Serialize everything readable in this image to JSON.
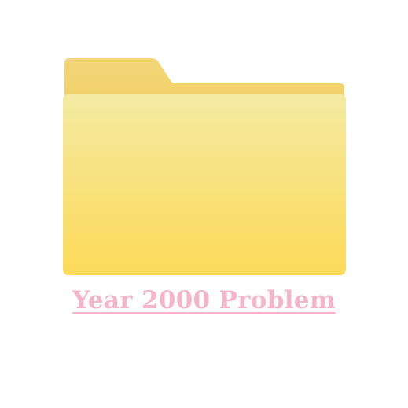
{
  "folder": {
    "icon": "folder-icon",
    "label": "Year 2000 Problem",
    "label_color": "#f6b4c8",
    "colors": {
      "tab_top": "#f3d778",
      "tab_bottom": "#ecc95a",
      "front_top": "#f4eaa2",
      "front_bottom": "#fdda58"
    }
  }
}
